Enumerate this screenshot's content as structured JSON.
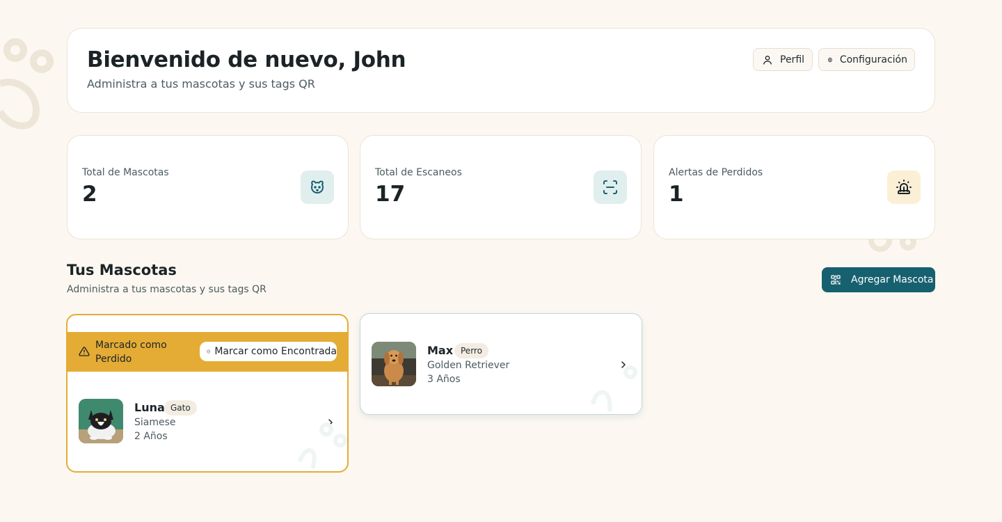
{
  "header": {
    "title": "Bienvenido de nuevo, John",
    "subtitle": "Administra a tus mascotas y sus tags QR",
    "profile_label": "Perfil",
    "settings_label": "Configuración"
  },
  "stats": [
    {
      "label": "Total de Mascotas",
      "value": "2",
      "icon": "pet-face-icon",
      "accent": "#17606f"
    },
    {
      "label": "Total de Escaneos",
      "value": "17",
      "icon": "scan-icon",
      "accent": "#17606f"
    },
    {
      "label": "Alertas de Perdidos",
      "value": "1",
      "icon": "siren-icon",
      "accent": "#1b2326"
    }
  ],
  "pets_section": {
    "title": "Tus Mascotas",
    "subtitle": "Administra a tus mascotas y sus tags QR",
    "add_label": "Agregar Mascota"
  },
  "pets": [
    {
      "name": "Luna",
      "type": "Gato",
      "breed": "Siamese",
      "age": "2 Años",
      "lost": true,
      "lost_label": "Marcado como Perdido",
      "found_label": "Marcar como Encontrada"
    },
    {
      "name": "Max",
      "type": "Perro",
      "breed": "Golden Retriever",
      "age": "3 Años",
      "lost": false
    }
  ],
  "colors": {
    "background": "#fcf8f1",
    "primary": "#17606f",
    "lost_accent": "#e4ac35",
    "text": "#1b2326",
    "muted": "#4c5a60"
  }
}
